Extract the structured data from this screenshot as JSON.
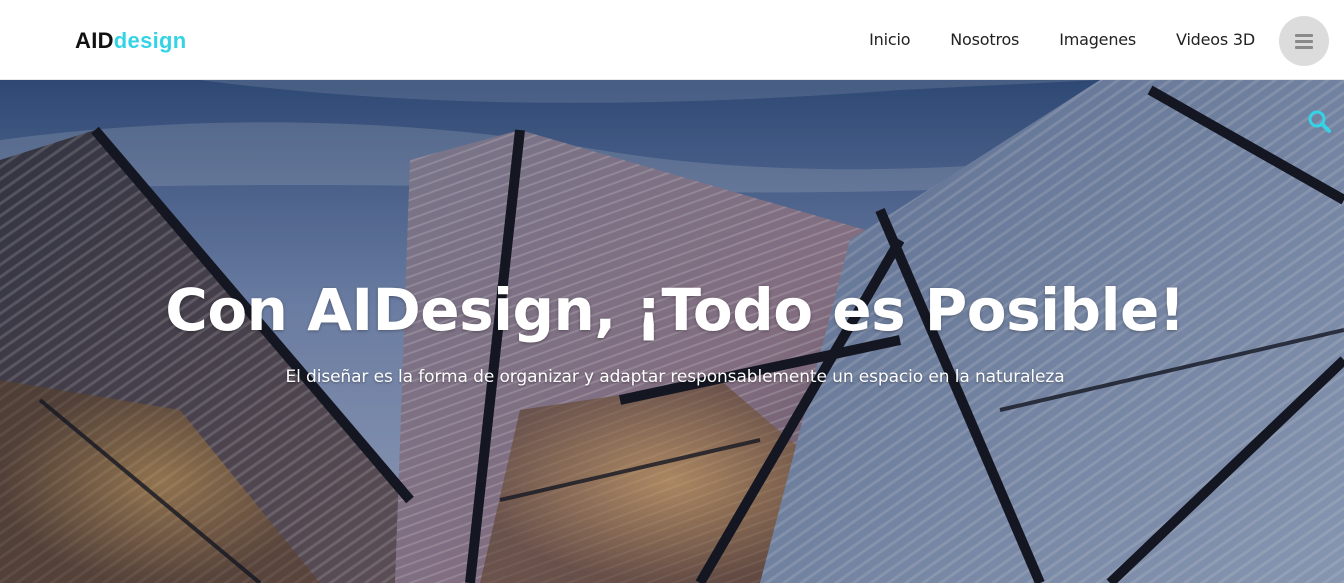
{
  "brand": {
    "logo_part1": "AID",
    "logo_part2": "design",
    "accent": "#35d3e6"
  },
  "nav": {
    "items": [
      {
        "label": "Inicio"
      },
      {
        "label": "Nosotros"
      },
      {
        "label": "Imagenes"
      },
      {
        "label": "Videos 3D"
      }
    ]
  },
  "header": {
    "menu_icon": "hamburger-icon"
  },
  "hero": {
    "title": "Con AIDesign, ¡Todo es Posible!",
    "subtitle": "El diseñar es la forma de organizar y adaptar responsablemente un espacio en la naturaleza",
    "search_icon": "search-icon",
    "image": "angular-glass-building"
  }
}
